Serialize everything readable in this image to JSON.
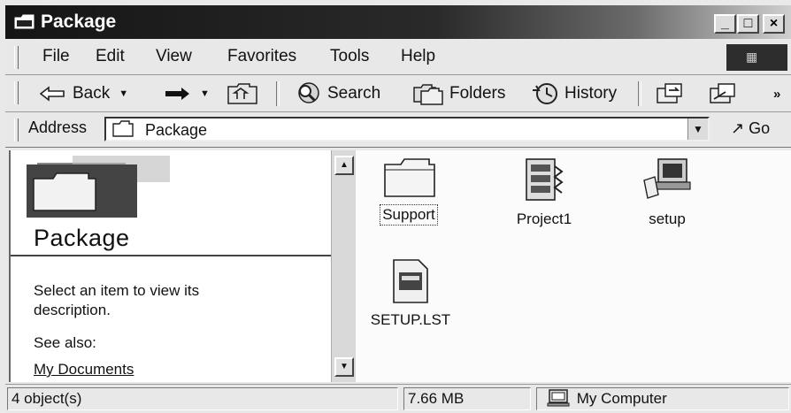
{
  "window": {
    "title": "Package"
  },
  "title_buttons": {
    "minimize": "_",
    "maximize": "□",
    "close": "×"
  },
  "menu": [
    {
      "label": "File"
    },
    {
      "label": "Edit"
    },
    {
      "label": "View"
    },
    {
      "label": "Favorites"
    },
    {
      "label": "Tools"
    },
    {
      "label": "Help"
    }
  ],
  "toolbar": {
    "back": "Back",
    "search": "Search",
    "folders": "Folders",
    "history": "History",
    "more": "»"
  },
  "address": {
    "label": "Address",
    "value": "Package",
    "go": "Go"
  },
  "left_pane": {
    "folder_title": "Package",
    "description": "Select an item to view its description.",
    "see_also": "See also:",
    "link": "My Documents"
  },
  "files": [
    {
      "name": "Support",
      "icon": "folder-icon"
    },
    {
      "name": "Project1",
      "icon": "compressed-file-icon"
    },
    {
      "name": "setup",
      "icon": "setup-program-icon"
    },
    {
      "name": "SETUP.LST",
      "icon": "lst-file-icon"
    }
  ],
  "status": {
    "objects": "4 object(s)",
    "size": "7.66 MB",
    "location": "My Computer"
  }
}
